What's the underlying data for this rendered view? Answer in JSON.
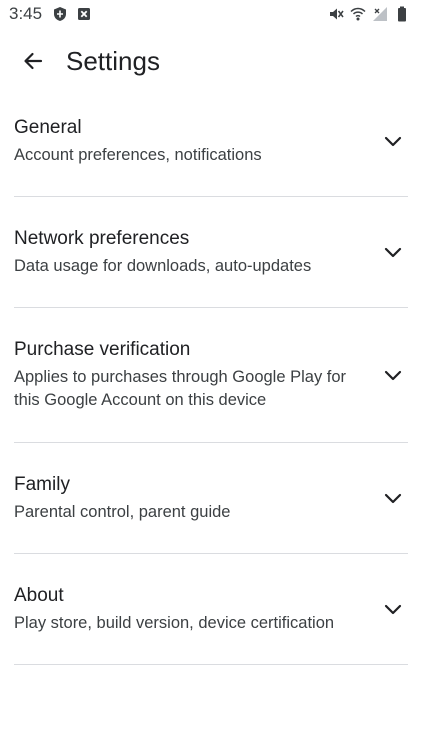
{
  "status_bar": {
    "time": "3:45",
    "left_icons": [
      "shield-icon",
      "notification-x-icon"
    ],
    "right_icons": [
      "vibrate-mute-icon",
      "wifi-icon",
      "no-signal-icon",
      "battery-icon"
    ]
  },
  "app_bar": {
    "title": "Settings",
    "back_icon": "arrow-back-icon"
  },
  "settings": [
    {
      "title": "General",
      "subtitle": "Account preferences, notifications"
    },
    {
      "title": "Network preferences",
      "subtitle": "Data usage for downloads, auto-updates"
    },
    {
      "title": "Purchase verification",
      "subtitle": "Applies to purchases through Google Play for this Google Account on this device"
    },
    {
      "title": "Family",
      "subtitle": "Parental control, parent guide"
    },
    {
      "title": "About",
      "subtitle": "Play store, build version, device certification"
    }
  ],
  "colors": {
    "text_primary": "#202124",
    "text_secondary": "#3c4043",
    "divider": "#dadce0"
  }
}
